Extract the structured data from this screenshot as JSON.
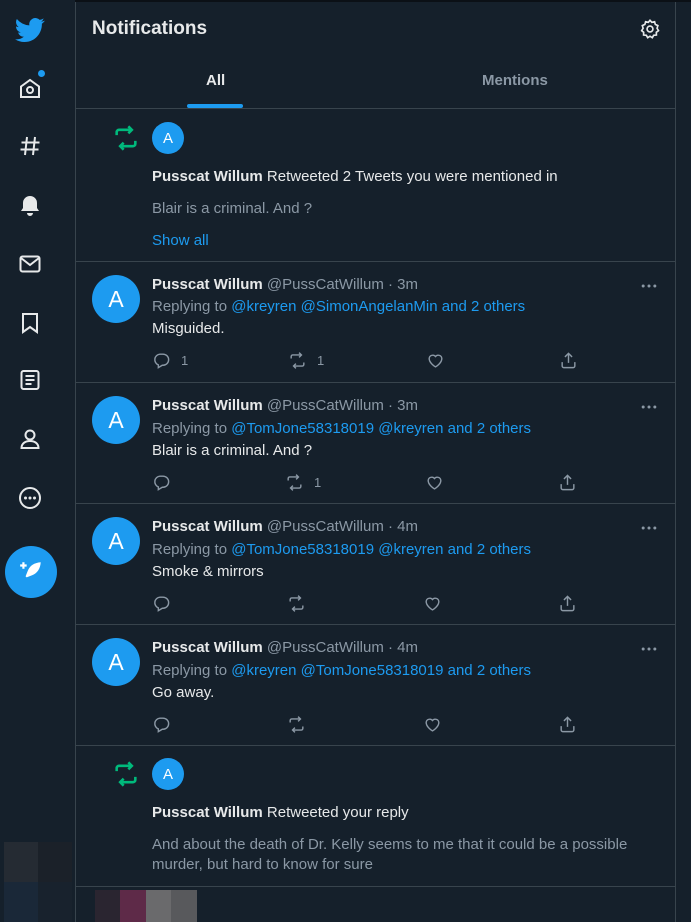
{
  "header": {
    "title": "Notifications"
  },
  "tabs": [
    {
      "label": "All"
    },
    {
      "label": "Mentions"
    }
  ],
  "sidebar": {
    "items": [
      {
        "name": "twitter-logo"
      },
      {
        "name": "home"
      },
      {
        "name": "explore"
      },
      {
        "name": "notifications"
      },
      {
        "name": "messages"
      },
      {
        "name": "bookmarks"
      },
      {
        "name": "lists"
      },
      {
        "name": "profile"
      },
      {
        "name": "more"
      }
    ],
    "compose_icon": "feather-plus-icon"
  },
  "notifications": [
    {
      "type": "retweet",
      "avatar_letter": "A",
      "actor": "Pusscat Willum",
      "action_text": "Retweeted 2 Tweets you were mentioned in",
      "body": "Blair is a criminal. And ?",
      "show_all": "Show all"
    },
    {
      "type": "tweet",
      "avatar_letter": "A",
      "name": "Pusscat Willum",
      "handle": "@PussCatWillum",
      "time": "· 3m",
      "replying_prefix": "Replying to",
      "replying_to": "@kreyren @SimonAngelanMin and 2 others",
      "text": "Misguided.",
      "reply_count": "1",
      "retweet_count": "1",
      "like_count": ""
    },
    {
      "type": "tweet",
      "avatar_letter": "A",
      "name": "Pusscat Willum",
      "handle": "@PussCatWillum",
      "time": "· 3m",
      "replying_prefix": "Replying to",
      "replying_to": "@TomJone58318019 @kreyren and 2 others",
      "text": "Blair is a criminal. And ?",
      "reply_count": "",
      "retweet_count": "1",
      "like_count": ""
    },
    {
      "type": "tweet",
      "avatar_letter": "A",
      "name": "Pusscat Willum",
      "handle": "@PussCatWillum",
      "time": "· 4m",
      "replying_prefix": "Replying to",
      "replying_to": "@TomJone58318019 @kreyren and 2 others",
      "text": "Smoke & mirrors",
      "reply_count": "",
      "retweet_count": "",
      "like_count": ""
    },
    {
      "type": "tweet",
      "avatar_letter": "A",
      "name": "Pusscat Willum",
      "handle": "@PussCatWillum",
      "time": "· 4m",
      "replying_prefix": "Replying to",
      "replying_to": "@kreyren @TomJone58318019 and 2 others",
      "text": "Go away.",
      "reply_count": "",
      "retweet_count": "",
      "like_count": ""
    },
    {
      "type": "retweet",
      "avatar_letter": "A",
      "actor": "Pusscat Willum",
      "action_text": "Retweeted your reply",
      "body": "And about the death of Dr. Kelly seems to me that it could be a possible murder, but hard to know for sure"
    }
  ],
  "colors": {
    "background": "#15202b",
    "accent": "#1d9bf0",
    "retweet": "#00ba7c",
    "muted_text": "#8b98a5",
    "border": "#38444d"
  }
}
